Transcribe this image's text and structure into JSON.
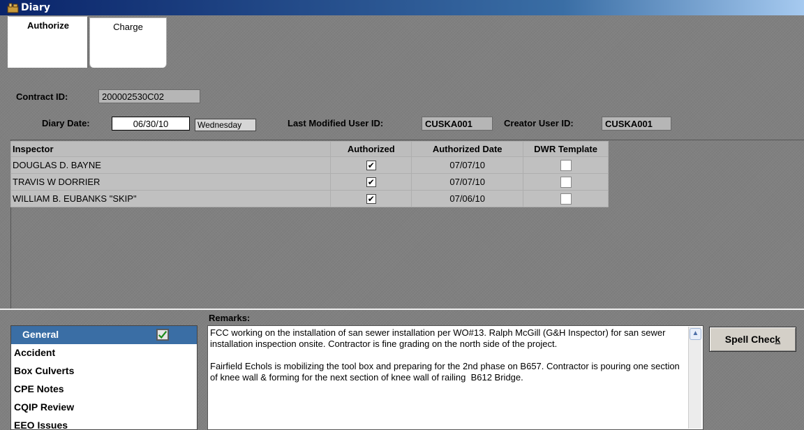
{
  "window": {
    "title": "Diary"
  },
  "tabs": [
    {
      "label": "Authorize",
      "active": true
    },
    {
      "label": "Charge",
      "active": false
    }
  ],
  "form": {
    "contract_id_label": "Contract ID:",
    "contract_id_value": "200002530C02",
    "diary_date_label": "Diary Date:",
    "diary_date_value": "06/30/10",
    "weekday_value": "Wednesday",
    "last_modified_label": "Last Modified User ID:",
    "last_modified_value": "CUSKA001",
    "creator_label": "Creator User ID:",
    "creator_value": "CUSKA001"
  },
  "inspectors": {
    "columns": [
      "Inspector",
      "Authorized",
      "Authorized Date",
      "DWR Template"
    ],
    "rows": [
      {
        "name": "DOUGLAS D. BAYNE",
        "authorized": true,
        "date": "07/07/10",
        "dwr": false
      },
      {
        "name": "TRAVIS W DORRIER",
        "authorized": true,
        "date": "07/07/10",
        "dwr": false
      },
      {
        "name": "WILLIAM B. EUBANKS \"SKIP\"",
        "authorized": true,
        "date": "07/06/10",
        "dwr": false
      }
    ]
  },
  "remarks": {
    "label": "Remarks:",
    "paragraph1": "FCC working on the installation of san sewer installation per WO#13. Ralph McGill (G&H Inspector) for san sewer installation inspection onsite. Contractor is fine grading on the north side of the project.",
    "paragraph2": "Fairfield Echols is mobilizing the tool box and preparing for the 2nd phase on B657. Contractor is pouring one section of knee wall & forming for the next section of knee wall of railing  B612 Bridge."
  },
  "nav": {
    "items": [
      "General",
      "Accident",
      "Box Culverts",
      "CPE Notes",
      "CQIP Review",
      "EEO Issues"
    ]
  },
  "buttons": {
    "spell_check_prefix": "Spell Chec",
    "spell_check_accel": "k"
  },
  "colors": {
    "titlebar": "#0a246a",
    "selection": "#3a6ea5",
    "background": "#808080"
  }
}
